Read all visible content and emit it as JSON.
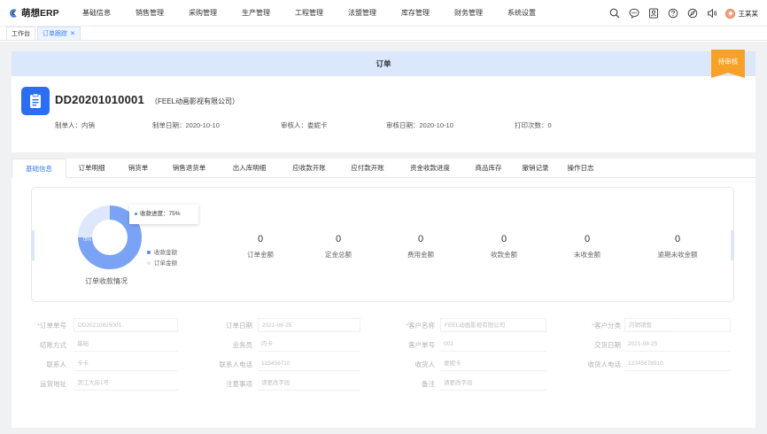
{
  "app": {
    "title": "萌想ERP",
    "brand_color": "#3b7ff0"
  },
  "nav": {
    "items": [
      "基础信息",
      "销售管理",
      "采购管理",
      "生产管理",
      "工程管理",
      "法盟管理",
      "库存管理",
      "财务管理",
      "系统设置"
    ]
  },
  "toolbar": {
    "icons": [
      "search-icon",
      "chat-icon",
      "contacts-icon",
      "help-icon",
      "explore-icon",
      "speaker-icon"
    ],
    "user_name": "王某某"
  },
  "page_tabs": [
    {
      "label": "工作台",
      "active": false
    },
    {
      "label": "订单跟踪",
      "active": true
    }
  ],
  "order": {
    "header_title": "订单",
    "status": "待审核",
    "number": "DD20201010001",
    "company": "（FEEL动画影视有限公司）",
    "meta": [
      {
        "label": "制单人：",
        "value": "内销"
      },
      {
        "label": "制单日期：",
        "value": "2020-10-10"
      },
      {
        "label": "审核人：",
        "value": "娄妮卡"
      },
      {
        "label": "审核日期：",
        "value": "2020-10-10"
      },
      {
        "label": "打印次数：",
        "value": "0"
      }
    ]
  },
  "sub_tabs": [
    "基础信息",
    "订单明细",
    "销货单",
    "销售退货单",
    "出入库明细",
    "应收款开账",
    "应付款开账",
    "资金收款进度",
    "商品库存",
    "撤销记录",
    "操作日志"
  ],
  "stats": {
    "donut": {
      "progress_percent": 75,
      "tooltip": "收款进度：75%",
      "center_label": "75%",
      "legend": [
        {
          "name": "收款金额",
          "color": "#4f84f5"
        },
        {
          "name": "订单金额",
          "color": "#dfe8fb"
        }
      ],
      "caption": "订单收款情况"
    },
    "items": [
      {
        "value": "0",
        "label": "订单金额"
      },
      {
        "value": "0",
        "label": "定金总额"
      },
      {
        "value": "0",
        "label": "费用金额"
      },
      {
        "value": "0",
        "label": "收款金额"
      },
      {
        "value": "0",
        "label": "未收金额"
      },
      {
        "value": "0",
        "label": "逾期未收金额"
      }
    ]
  },
  "form": {
    "rows": [
      [
        {
          "label": "订单单号",
          "required": true,
          "value": "DD20210825001"
        },
        {
          "label": "订单日期",
          "required": false,
          "value": "2021-08-25"
        },
        {
          "label": "客户名称",
          "required": true,
          "value": "FEEL动画影视有限公司"
        },
        {
          "label": "客户分类",
          "required": true,
          "value": "内销销售"
        }
      ],
      [
        {
          "label": "结账方式",
          "required": false,
          "value": "基础"
        },
        {
          "label": "业务员",
          "required": false,
          "value": "内卡"
        },
        {
          "label": "客户单号",
          "required": false,
          "value": "001"
        },
        {
          "label": "交货日期",
          "required": false,
          "value": "2021-08-25"
        }
      ],
      [
        {
          "label": "联系人",
          "required": false,
          "value": "卡卡"
        },
        {
          "label": "联系人电话",
          "required": false,
          "value": "123456710"
        },
        {
          "label": "收货人",
          "required": false,
          "value": "娄妮卡"
        },
        {
          "label": "收货人电话",
          "required": false,
          "value": "12345678910"
        }
      ],
      [
        {
          "label": "运货地址",
          "required": false,
          "value": "滨江大街1号"
        },
        {
          "label": "注意事项",
          "required": false,
          "value": "请更改字段"
        },
        {
          "label": "备注",
          "required": false,
          "value": "请更改字段"
        }
      ]
    ]
  }
}
